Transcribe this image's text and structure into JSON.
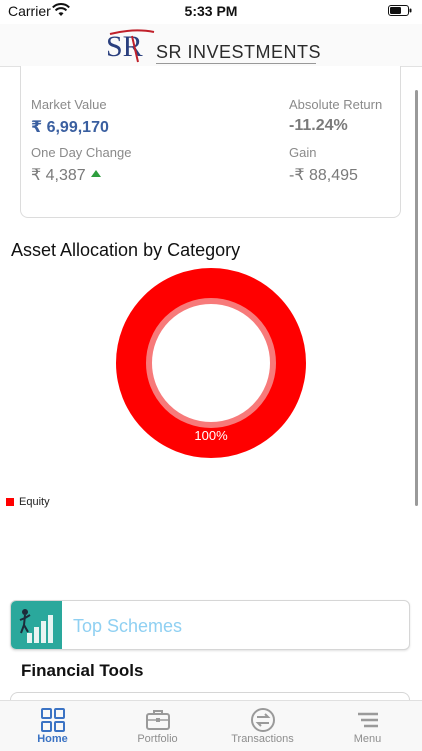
{
  "status_bar": {
    "carrier": "Carrier",
    "time": "5:33 PM"
  },
  "header": {
    "brand_name": "SR INVESTMENTS",
    "logo_letters": "SR"
  },
  "summary": {
    "market_value_label": "Market Value",
    "market_value": "₹ 6,99,170",
    "absolute_return_label": "Absolute Return",
    "absolute_return": "-11.24%",
    "one_day_change_label": "One Day Change",
    "one_day_change": "₹ 4,387",
    "gain_label": "Gain",
    "gain": "-₹ 88,495"
  },
  "allocation": {
    "title": "Asset Allocation by Category",
    "center_label": "100%",
    "legend": [
      {
        "label": "Equity",
        "color": "#ff0000"
      }
    ]
  },
  "chart_data": {
    "type": "pie",
    "title": "Asset Allocation by Category",
    "categories": [
      "Equity"
    ],
    "values": [
      100
    ],
    "colors": [
      "#ff0000"
    ],
    "legend": "bottom-left"
  },
  "top_schemes": {
    "label": "Top Schemes",
    "icon": "growth-chart-icon"
  },
  "financial_tools": {
    "title": "Financial Tools"
  },
  "tab_bar": {
    "tabs": [
      {
        "label": "Home",
        "icon": "grid-icon",
        "active": true
      },
      {
        "label": "Portfolio",
        "icon": "briefcase-icon",
        "active": false
      },
      {
        "label": "Transactions",
        "icon": "exchange-icon",
        "active": false
      },
      {
        "label": "Menu",
        "icon": "menu-icon",
        "active": false
      }
    ]
  },
  "colors": {
    "accent": "#3b73c4",
    "value_blue": "#3a5fa0",
    "up_green": "#2e9e3e",
    "teal": "#2aa89c",
    "scheme_text": "#8fd0f2"
  }
}
